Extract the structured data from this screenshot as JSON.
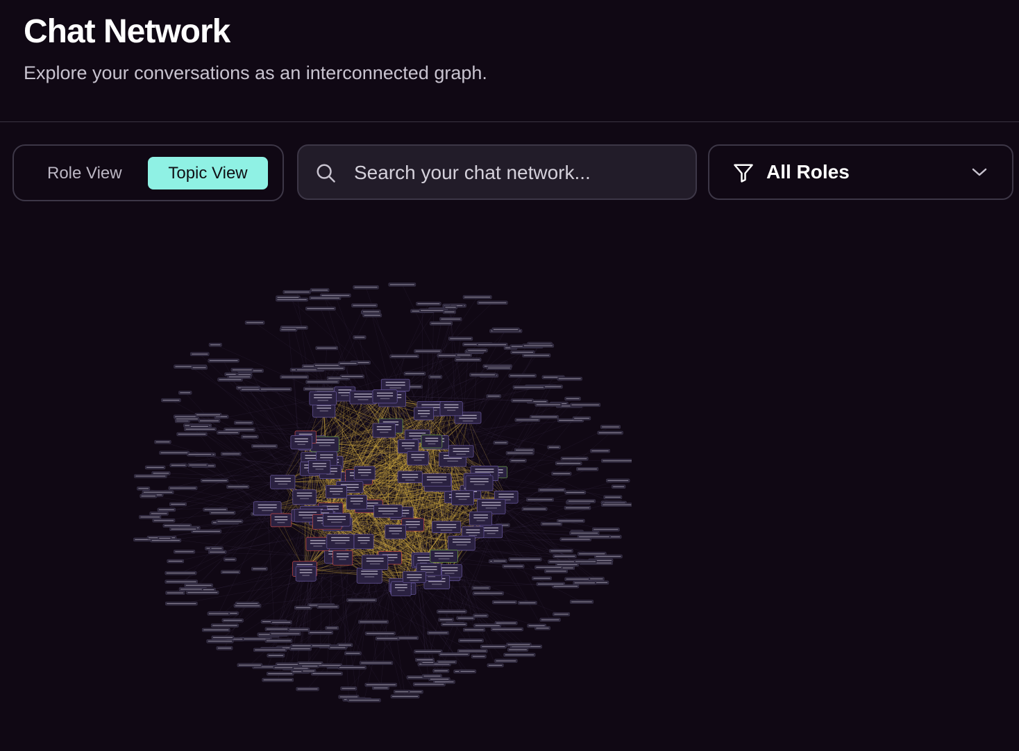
{
  "header": {
    "title": "Chat Network",
    "subtitle": "Explore your conversations as an interconnected graph."
  },
  "view_toggle": {
    "options": [
      "Role View",
      "Topic View"
    ],
    "selected": "Topic View"
  },
  "search": {
    "placeholder": "Search your chat network...",
    "value": ""
  },
  "role_filter": {
    "selected": "All Roles"
  },
  "colors": {
    "background": "#100814",
    "accent": "#8ff1e4",
    "edge": "#e0b844",
    "node_fill": "#2a2140",
    "node_border_default": "#6a5aa0",
    "node_border_red": "#c94a4a",
    "node_border_green": "#6fa54a"
  },
  "icons": {
    "search": "search-icon",
    "filter": "filter-icon",
    "chevron": "chevron-down-icon"
  }
}
